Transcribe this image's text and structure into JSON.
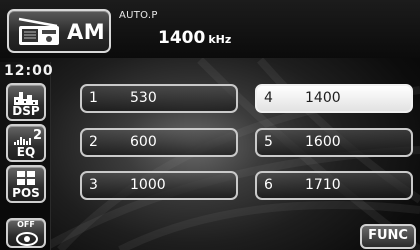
{
  "header": {
    "source_label": "AM",
    "mode_text": "AUTO.P",
    "frequency": "1400",
    "frequency_unit": "kHz"
  },
  "sidebar": {
    "clock": "12:00",
    "buttons": [
      {
        "label": "DSP",
        "icon": "dsp-icon"
      },
      {
        "label": "EQ",
        "icon": "eq-icon",
        "badge": "2"
      },
      {
        "label": "POS",
        "icon": "pos-icon"
      },
      {
        "label": "OFF",
        "icon": "speaker-off-icon"
      }
    ]
  },
  "presets": [
    {
      "number": "1",
      "value": "530"
    },
    {
      "number": "2",
      "value": "600"
    },
    {
      "number": "3",
      "value": "1000"
    },
    {
      "number": "4",
      "value": "1400",
      "selected": true
    },
    {
      "number": "5",
      "value": "1600"
    },
    {
      "number": "6",
      "value": "1710"
    }
  ],
  "func_label": "FUNC",
  "colors": {
    "button_border": "#d0d0d0",
    "selected_bg": "#f2f2f2",
    "text": "#ffffff"
  }
}
